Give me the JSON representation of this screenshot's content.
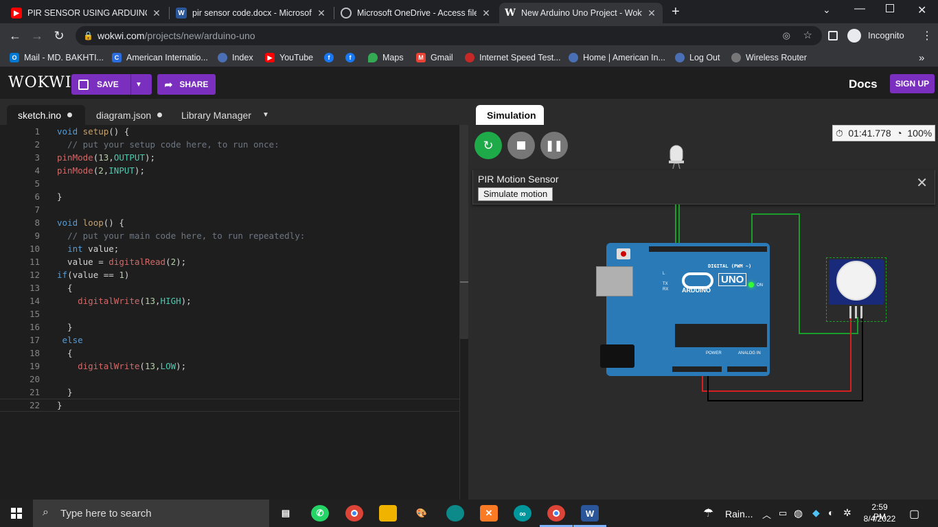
{
  "browser": {
    "tabs": [
      {
        "title": "PIR SENSOR USING ARDUINO - Y",
        "favicon": "youtube-icon"
      },
      {
        "title": "pir sensor code.docx - Microsoft",
        "favicon": "word-icon"
      },
      {
        "title": "Microsoft OneDrive - Access files",
        "favicon": "globe-icon"
      },
      {
        "title": "New Arduino Uno Project - Wokw",
        "favicon": "wokwi-icon",
        "active": true
      }
    ],
    "url_host": "wokwi.com",
    "url_path": "/projects/new/arduino-uno",
    "profile_label": "Incognito",
    "bookmarks": [
      "Mail - MD. BAKHTI...",
      "American Internatio...",
      "Index",
      "YouTube",
      "",
      "",
      "Maps",
      "Gmail",
      "Internet Speed Test...",
      "Home | American In...",
      "Log Out",
      "Wireless Router"
    ]
  },
  "wokwi": {
    "logo": "WOKWI",
    "save_label": "SAVE",
    "share_label": "SHARE",
    "docs_label": "Docs",
    "signup_label": "SIGN UP",
    "editor_tabs": [
      "sketch.ino",
      "diagram.json",
      "Library Manager"
    ],
    "sim_tab": "Simulation",
    "timer": "01:41.778",
    "speed": "100%",
    "pir_title": "PIR Motion Sensor",
    "simulate_label": "Simulate motion",
    "board_labels": {
      "uno": "UNO",
      "arduino": "ARDUINO",
      "digital": "DIGITAL (PWM ~)",
      "analog": "ANALOG IN",
      "power": "POWER",
      "on": "ON",
      "tx": "TX",
      "rx": "RX",
      "l": "L"
    }
  },
  "code_lines": [
    "void setup() {",
    "  // put your setup code here, to run once:",
    "pinMode(13,OUTPUT);",
    "pinMode(2,INPUT);",
    "",
    "}",
    "",
    "void loop() {",
    "  // put your main code here, to run repeatedly:",
    "  int value;",
    "  value = digitalRead(2);",
    "if(value == 1)",
    "  {",
    "    digitalWrite(13,HIGH);",
    "",
    "  }",
    " else",
    "  {",
    "    digitalWrite(13,LOW);",
    "",
    "  }",
    "}"
  ],
  "taskbar": {
    "search_placeholder": "Type here to search",
    "weather": "Rain...",
    "time": "2:59 PM",
    "date": "8/4/2022"
  },
  "colors": {
    "accent": "#7b2fbe",
    "board": "#2b7ab8",
    "wire_green": "#1a9e2a",
    "wire_red": "#d62020",
    "wire_black": "#000000"
  }
}
